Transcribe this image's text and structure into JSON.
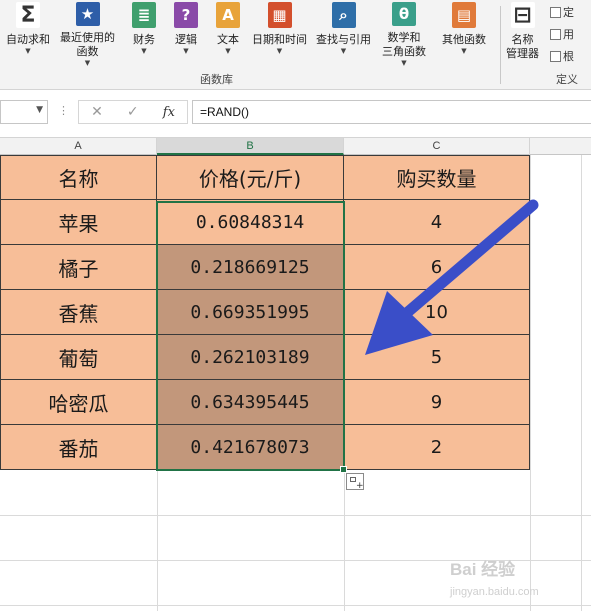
{
  "ribbon": {
    "buttons": [
      {
        "icon": "sigma-icon",
        "glyph": "Σ",
        "label1": "自动求和",
        "color": "#ffffff"
      },
      {
        "icon": "star-icon",
        "glyph": "★",
        "label1": "最近使用的",
        "label2": "函数",
        "color": "#2e5ea8"
      },
      {
        "icon": "money-stack-icon",
        "glyph": "≣",
        "label1": "财务",
        "color": "#3f9f6d"
      },
      {
        "icon": "question-icon",
        "glyph": "?",
        "label1": "逻辑",
        "color": "#8a4aa8"
      },
      {
        "icon": "text-a-icon",
        "glyph": "A",
        "label1": "文本",
        "color": "#e8a33a"
      },
      {
        "icon": "calendar-icon",
        "glyph": "▦",
        "label1": "日期和时间",
        "color": "#d34f2c"
      },
      {
        "icon": "lookup-icon",
        "glyph": "⌕",
        "label1": "查找与引用",
        "color": "#2e6ea8"
      },
      {
        "icon": "theta-icon",
        "glyph": "θ",
        "label1": "数学和",
        "label2": "三角函数",
        "color": "#3a9f8a"
      },
      {
        "icon": "more-functions-icon",
        "glyph": "▤",
        "label1": "其他函数",
        "color": "#e07a3a"
      },
      {
        "icon": "tag-icon",
        "glyph": "⊟",
        "label1": "名称",
        "label2": "管理器",
        "color": "#ffffff"
      }
    ],
    "group_label": "函数库",
    "group_label2": "定义",
    "mini_commands": [
      "定",
      "用",
      "根"
    ]
  },
  "formula_bar": {
    "name_box": "",
    "cancel": "✕",
    "confirm": "✓",
    "fx": "fx",
    "formula": "=RAND()"
  },
  "columns": [
    "A",
    "B",
    "C"
  ],
  "table": {
    "headers": [
      "名称",
      "价格(元/斤)",
      "购买数量"
    ],
    "rows": [
      {
        "name": "苹果",
        "price": "0.60848314",
        "qty": "4"
      },
      {
        "name": "橘子",
        "price": "0.218669125",
        "qty": "6"
      },
      {
        "name": "香蕉",
        "price": "0.669351995",
        "qty": "10"
      },
      {
        "name": "葡萄",
        "price": "0.262103189",
        "qty": "5"
      },
      {
        "name": "哈密瓜",
        "price": "0.634395445",
        "qty": "9"
      },
      {
        "name": "番茄",
        "price": "0.421678073",
        "qty": "2"
      }
    ]
  },
  "colors": {
    "cell_fill": "#f7be98",
    "selected_fill": "#c2977b",
    "selection_border": "#217346",
    "arrow": "#3a4ec8"
  },
  "watermark": "Bai 经验",
  "watermark_sub": "jingyan.baidu.com"
}
